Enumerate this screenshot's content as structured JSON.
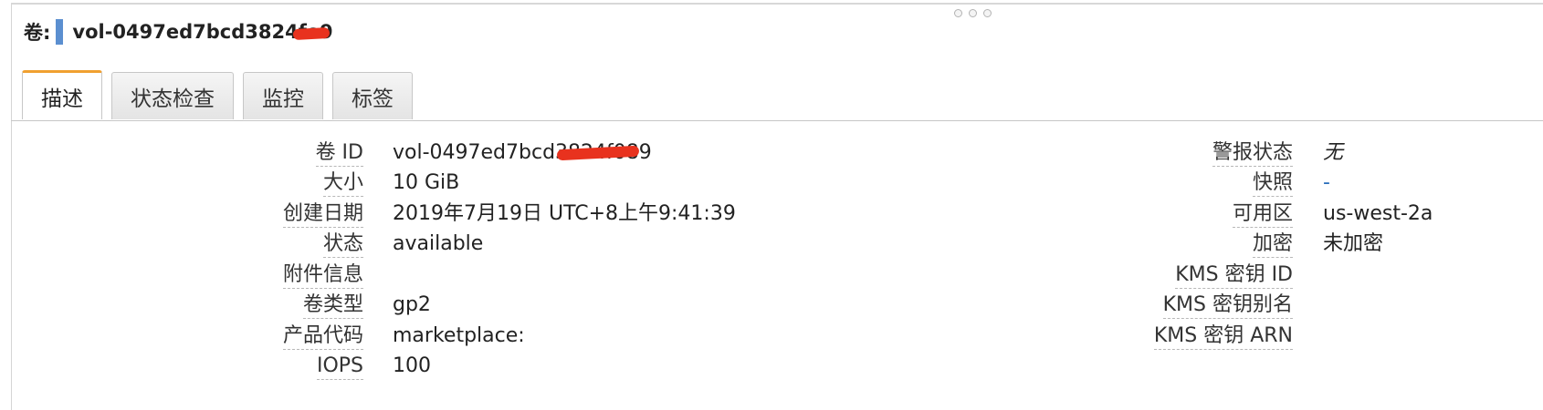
{
  "header": {
    "prefix": "卷:",
    "volume_id": "vol-0497ed7bcd3824fe9"
  },
  "tabs": [
    {
      "label": "描述",
      "active": true
    },
    {
      "label": "状态检查",
      "active": false
    },
    {
      "label": "监控",
      "active": false
    },
    {
      "label": "标签",
      "active": false
    }
  ],
  "left_fields": [
    {
      "label": "卷 ID",
      "value": "vol-0497ed7bcd3824f089"
    },
    {
      "label": "大小",
      "value": "10 GiB"
    },
    {
      "label": "创建日期",
      "value": "2019年7月19日 UTC+8上午9:41:39"
    },
    {
      "label": "状态",
      "value": "available"
    },
    {
      "label": "附件信息",
      "value": ""
    },
    {
      "label": "卷类型",
      "value": "gp2"
    },
    {
      "label": "产品代码",
      "value": "marketplace:"
    },
    {
      "label": "IOPS",
      "value": "100"
    }
  ],
  "right_fields": [
    {
      "label": "警报状态",
      "value": "无"
    },
    {
      "label": "快照",
      "value": "-"
    },
    {
      "label": "可用区",
      "value": "us-west-2a"
    },
    {
      "label": "加密",
      "value": "未加密"
    },
    {
      "label": "KMS 密钥 ID",
      "value": ""
    },
    {
      "label": "KMS 密钥别名",
      "value": ""
    },
    {
      "label": "KMS 密钥 ARN",
      "value": ""
    }
  ],
  "colors": {
    "active_tab_accent": "#f0a030",
    "header_bar": "#5b8fd0",
    "redaction": "#e8321e",
    "link": "#2a6ebb"
  }
}
